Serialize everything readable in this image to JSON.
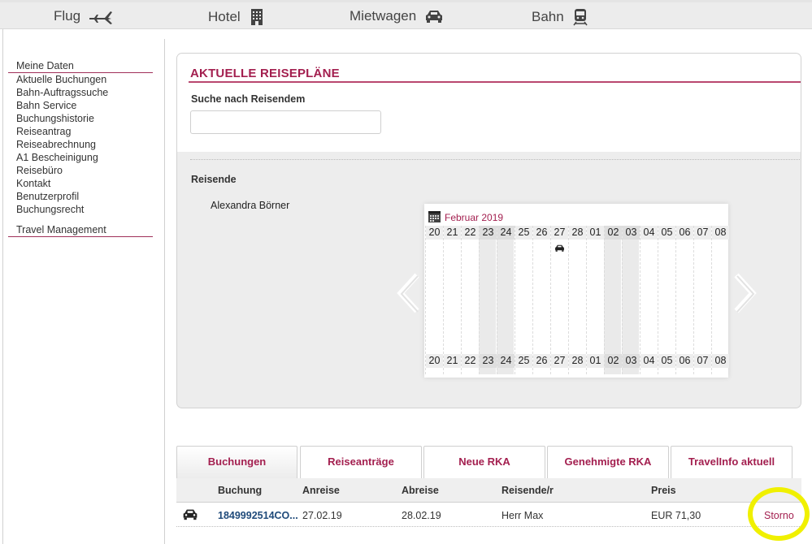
{
  "topnav": {
    "items": [
      {
        "label": "Flug",
        "icon": "plane-icon"
      },
      {
        "label": "Hotel",
        "icon": "building-icon"
      },
      {
        "label": "Mietwagen",
        "icon": "car-icon"
      },
      {
        "label": "Bahn",
        "icon": "train-icon"
      }
    ]
  },
  "sidebar": {
    "section1": "Meine Daten",
    "items": [
      "Aktuelle Buchungen",
      "Bahn-Auftragssuche",
      "Bahn Service",
      "Buchungshistorie",
      "Reiseantrag",
      "Reiseabrechnung",
      "A1 Bescheinigung",
      "Reisebüro",
      "Kontakt",
      "Benutzerprofil",
      "Buchungsrecht"
    ],
    "section2": "Travel Management"
  },
  "main": {
    "title": "AKTUELLE REISEPLÄNE",
    "search_label": "Suche nach Reisendem",
    "search_value": "",
    "reisende_label": "Reisende",
    "traveler_name": "Alexandra Börner"
  },
  "calendar": {
    "month": "Februar 2019",
    "days": [
      {
        "d": "20",
        "weekend": false
      },
      {
        "d": "21",
        "weekend": false
      },
      {
        "d": "22",
        "weekend": false
      },
      {
        "d": "23",
        "weekend": true
      },
      {
        "d": "24",
        "weekend": true
      },
      {
        "d": "25",
        "weekend": false
      },
      {
        "d": "26",
        "weekend": false
      },
      {
        "d": "27",
        "weekend": false,
        "booking": "car-icon"
      },
      {
        "d": "28",
        "weekend": false
      },
      {
        "d": "01",
        "weekend": false
      },
      {
        "d": "02",
        "weekend": true
      },
      {
        "d": "03",
        "weekend": true
      },
      {
        "d": "04",
        "weekend": false
      },
      {
        "d": "05",
        "weekend": false
      },
      {
        "d": "06",
        "weekend": false
      },
      {
        "d": "07",
        "weekend": false
      },
      {
        "d": "08",
        "weekend": false
      }
    ]
  },
  "tabs": [
    {
      "label": "Buchungen",
      "active": true
    },
    {
      "label": "Reiseanträge",
      "active": false
    },
    {
      "label": "Neue RKA",
      "active": false
    },
    {
      "label": "Genehmigte RKA",
      "active": false
    },
    {
      "label": "TravelInfo aktuell",
      "active": false
    }
  ],
  "table": {
    "headers": {
      "buchung": "Buchung",
      "anreise": "Anreise",
      "abreise": "Abreise",
      "reisende": "Reisende/r",
      "preis": "Preis"
    },
    "rows": [
      {
        "type_icon": "car-icon",
        "buchung": "1849992514CO...",
        "anreise": "27.02.19",
        "abreise": "28.02.19",
        "reisende": "Herr Max",
        "preis": "EUR 71,30",
        "action": "Storno"
      }
    ]
  },
  "colors": {
    "accent": "#a31f4f",
    "link": "#1f4a7a",
    "highlight": "#f0f000"
  }
}
